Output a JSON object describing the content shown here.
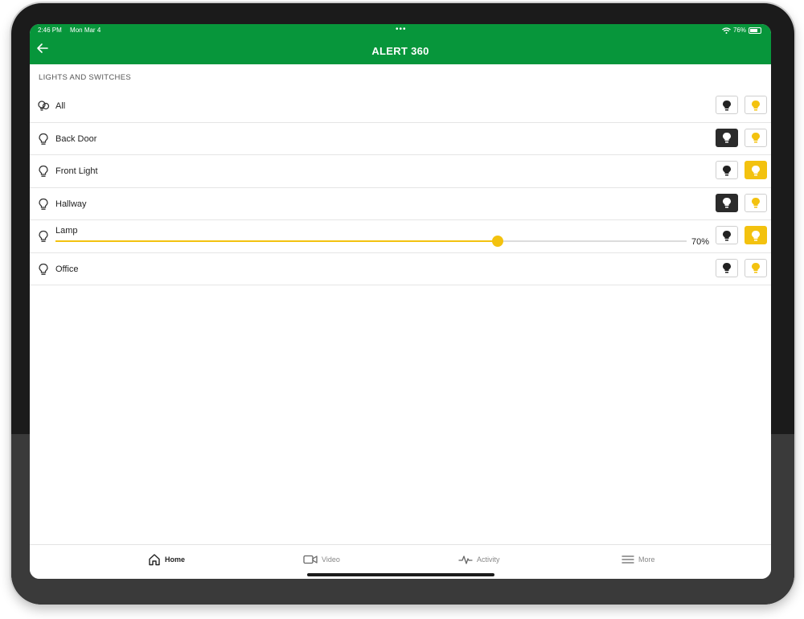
{
  "status_bar": {
    "time": "2:46 PM",
    "date": "Mon Mar 4",
    "dots": "•••",
    "battery_text": "76%"
  },
  "header": {
    "title": "ALERT 360"
  },
  "section": {
    "label": "LIGHTS AND SWITCHES"
  },
  "lights": [
    {
      "label": "All",
      "icon": "multi-bulb-icon",
      "state": "none"
    },
    {
      "label": "Back Door",
      "icon": "bulb-icon",
      "state": "off"
    },
    {
      "label": "Front Light",
      "icon": "bulb-icon",
      "state": "on"
    },
    {
      "label": "Hallway",
      "icon": "bulb-icon",
      "state": "off"
    },
    {
      "label": "Lamp",
      "icon": "bulb-icon",
      "state": "on",
      "dimmer_percent": 70,
      "dimmer_text": "70%"
    },
    {
      "label": "Office",
      "icon": "bulb-icon",
      "state": "none"
    }
  ],
  "colors": {
    "brand_green": "#07963b",
    "accent_yellow": "#f3c20f",
    "off_dark": "#2b2b2b"
  },
  "tabs": [
    {
      "label": "Home",
      "icon": "home-icon",
      "active": true
    },
    {
      "label": "Video",
      "icon": "video-camera-icon",
      "active": false
    },
    {
      "label": "Activity",
      "icon": "activity-pulse-icon",
      "active": false
    },
    {
      "label": "More",
      "icon": "hamburger-menu-icon",
      "active": false
    }
  ]
}
